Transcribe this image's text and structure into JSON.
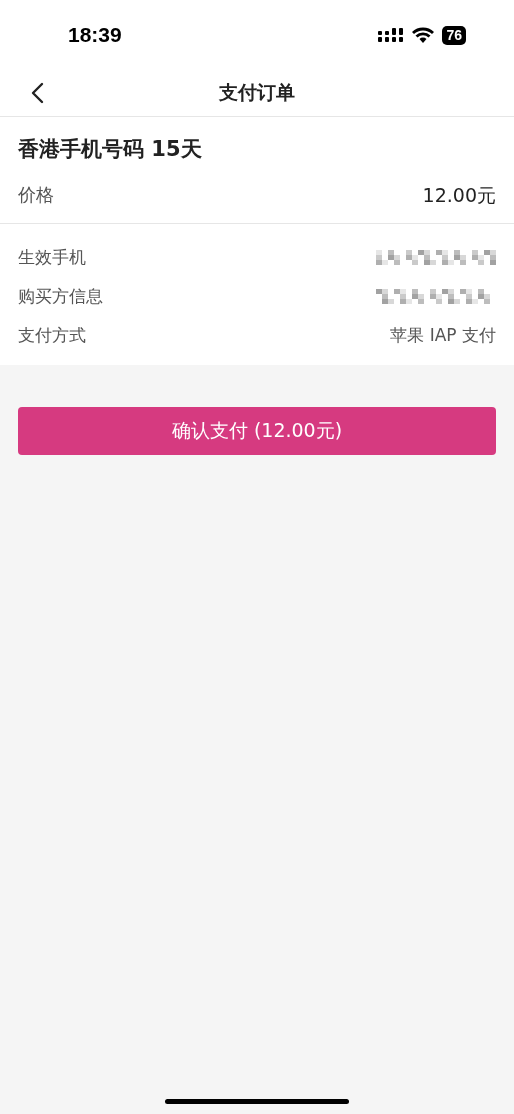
{
  "status_bar": {
    "time": "18:39",
    "battery": "76"
  },
  "nav": {
    "title": "支付订单"
  },
  "product": {
    "name": "香港手机号码 15天",
    "price_label": "价格",
    "price": "12.00元"
  },
  "details": [
    {
      "label": "生效手机",
      "kind": "redacted"
    },
    {
      "label": "购买方信息",
      "kind": "redacted"
    },
    {
      "label": "支付方式",
      "kind": "text",
      "value": "苹果 IAP 支付"
    }
  ],
  "confirm_button": {
    "label": "确认支付 (12.00元)"
  }
}
